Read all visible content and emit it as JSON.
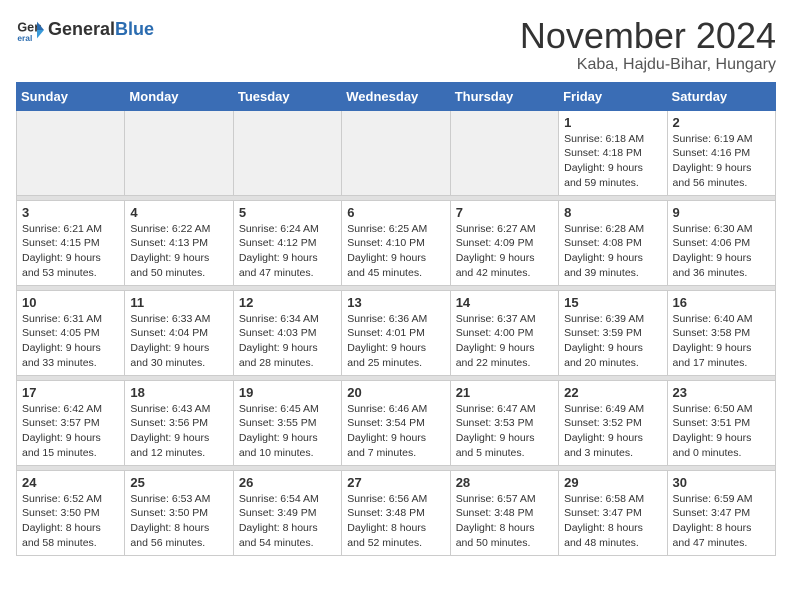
{
  "header": {
    "logo_general": "General",
    "logo_blue": "Blue",
    "month": "November 2024",
    "location": "Kaba, Hajdu-Bihar, Hungary"
  },
  "weekdays": [
    "Sunday",
    "Monday",
    "Tuesday",
    "Wednesday",
    "Thursday",
    "Friday",
    "Saturday"
  ],
  "weeks": [
    [
      {
        "day": "",
        "info": ""
      },
      {
        "day": "",
        "info": ""
      },
      {
        "day": "",
        "info": ""
      },
      {
        "day": "",
        "info": ""
      },
      {
        "day": "",
        "info": ""
      },
      {
        "day": "1",
        "info": "Sunrise: 6:18 AM\nSunset: 4:18 PM\nDaylight: 9 hours\nand 59 minutes."
      },
      {
        "day": "2",
        "info": "Sunrise: 6:19 AM\nSunset: 4:16 PM\nDaylight: 9 hours\nand 56 minutes."
      }
    ],
    [
      {
        "day": "3",
        "info": "Sunrise: 6:21 AM\nSunset: 4:15 PM\nDaylight: 9 hours\nand 53 minutes."
      },
      {
        "day": "4",
        "info": "Sunrise: 6:22 AM\nSunset: 4:13 PM\nDaylight: 9 hours\nand 50 minutes."
      },
      {
        "day": "5",
        "info": "Sunrise: 6:24 AM\nSunset: 4:12 PM\nDaylight: 9 hours\nand 47 minutes."
      },
      {
        "day": "6",
        "info": "Sunrise: 6:25 AM\nSunset: 4:10 PM\nDaylight: 9 hours\nand 45 minutes."
      },
      {
        "day": "7",
        "info": "Sunrise: 6:27 AM\nSunset: 4:09 PM\nDaylight: 9 hours\nand 42 minutes."
      },
      {
        "day": "8",
        "info": "Sunrise: 6:28 AM\nSunset: 4:08 PM\nDaylight: 9 hours\nand 39 minutes."
      },
      {
        "day": "9",
        "info": "Sunrise: 6:30 AM\nSunset: 4:06 PM\nDaylight: 9 hours\nand 36 minutes."
      }
    ],
    [
      {
        "day": "10",
        "info": "Sunrise: 6:31 AM\nSunset: 4:05 PM\nDaylight: 9 hours\nand 33 minutes."
      },
      {
        "day": "11",
        "info": "Sunrise: 6:33 AM\nSunset: 4:04 PM\nDaylight: 9 hours\nand 30 minutes."
      },
      {
        "day": "12",
        "info": "Sunrise: 6:34 AM\nSunset: 4:03 PM\nDaylight: 9 hours\nand 28 minutes."
      },
      {
        "day": "13",
        "info": "Sunrise: 6:36 AM\nSunset: 4:01 PM\nDaylight: 9 hours\nand 25 minutes."
      },
      {
        "day": "14",
        "info": "Sunrise: 6:37 AM\nSunset: 4:00 PM\nDaylight: 9 hours\nand 22 minutes."
      },
      {
        "day": "15",
        "info": "Sunrise: 6:39 AM\nSunset: 3:59 PM\nDaylight: 9 hours\nand 20 minutes."
      },
      {
        "day": "16",
        "info": "Sunrise: 6:40 AM\nSunset: 3:58 PM\nDaylight: 9 hours\nand 17 minutes."
      }
    ],
    [
      {
        "day": "17",
        "info": "Sunrise: 6:42 AM\nSunset: 3:57 PM\nDaylight: 9 hours\nand 15 minutes."
      },
      {
        "day": "18",
        "info": "Sunrise: 6:43 AM\nSunset: 3:56 PM\nDaylight: 9 hours\nand 12 minutes."
      },
      {
        "day": "19",
        "info": "Sunrise: 6:45 AM\nSunset: 3:55 PM\nDaylight: 9 hours\nand 10 minutes."
      },
      {
        "day": "20",
        "info": "Sunrise: 6:46 AM\nSunset: 3:54 PM\nDaylight: 9 hours\nand 7 minutes."
      },
      {
        "day": "21",
        "info": "Sunrise: 6:47 AM\nSunset: 3:53 PM\nDaylight: 9 hours\nand 5 minutes."
      },
      {
        "day": "22",
        "info": "Sunrise: 6:49 AM\nSunset: 3:52 PM\nDaylight: 9 hours\nand 3 minutes."
      },
      {
        "day": "23",
        "info": "Sunrise: 6:50 AM\nSunset: 3:51 PM\nDaylight: 9 hours\nand 0 minutes."
      }
    ],
    [
      {
        "day": "24",
        "info": "Sunrise: 6:52 AM\nSunset: 3:50 PM\nDaylight: 8 hours\nand 58 minutes."
      },
      {
        "day": "25",
        "info": "Sunrise: 6:53 AM\nSunset: 3:50 PM\nDaylight: 8 hours\nand 56 minutes."
      },
      {
        "day": "26",
        "info": "Sunrise: 6:54 AM\nSunset: 3:49 PM\nDaylight: 8 hours\nand 54 minutes."
      },
      {
        "day": "27",
        "info": "Sunrise: 6:56 AM\nSunset: 3:48 PM\nDaylight: 8 hours\nand 52 minutes."
      },
      {
        "day": "28",
        "info": "Sunrise: 6:57 AM\nSunset: 3:48 PM\nDaylight: 8 hours\nand 50 minutes."
      },
      {
        "day": "29",
        "info": "Sunrise: 6:58 AM\nSunset: 3:47 PM\nDaylight: 8 hours\nand 48 minutes."
      },
      {
        "day": "30",
        "info": "Sunrise: 6:59 AM\nSunset: 3:47 PM\nDaylight: 8 hours\nand 47 minutes."
      }
    ]
  ]
}
